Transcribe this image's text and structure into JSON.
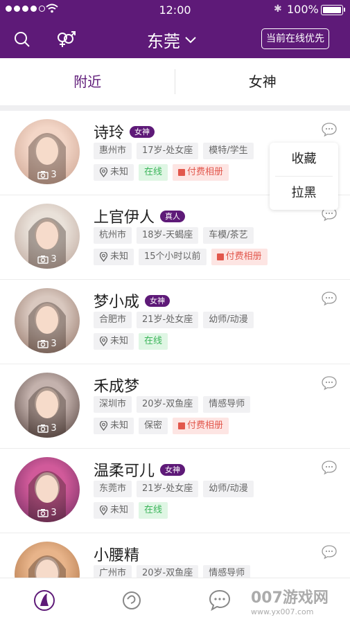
{
  "status_bar": {
    "time": "12:00",
    "battery": "100%",
    "battery_level": 1.0
  },
  "nav": {
    "city": "东莞",
    "online_first": "当前在线优先"
  },
  "tabs": [
    {
      "label": "附近",
      "active": true
    },
    {
      "label": "女神",
      "active": false
    }
  ],
  "popup_menu": {
    "favorite": "收藏",
    "block": "拉黑"
  },
  "users": [
    {
      "name": "诗玲",
      "badge": "女神",
      "photo_count": "3",
      "tags1": [
        "惠州市",
        "17岁-处女座",
        "模特/学生"
      ],
      "location": "未知",
      "status": "在线",
      "status_kind": "online",
      "paid": "付费相册"
    },
    {
      "name": "上官伊人",
      "badge": "真人",
      "photo_count": "3",
      "tags1": [
        "杭州市",
        "18岁-天蝎座",
        "车模/茶艺"
      ],
      "location": "未知",
      "status": "15个小时以前",
      "status_kind": "plain",
      "paid": "付费相册"
    },
    {
      "name": "梦小成",
      "badge": "女神",
      "photo_count": "3",
      "tags1": [
        "合肥市",
        "21岁-处女座",
        "幼师/动漫"
      ],
      "location": "未知",
      "status": "在线",
      "status_kind": "online",
      "paid": ""
    },
    {
      "name": "禾成梦",
      "badge": "",
      "photo_count": "3",
      "tags1": [
        "深圳市",
        "20岁-双鱼座",
        "情感导师"
      ],
      "location": "未知",
      "status": "保密",
      "status_kind": "plain",
      "paid": "付费相册"
    },
    {
      "name": "温柔可儿",
      "badge": "女神",
      "photo_count": "3",
      "tags1": [
        "东莞市",
        "21岁-处女座",
        "幼师/动漫"
      ],
      "location": "未知",
      "status": "在线",
      "status_kind": "online",
      "paid": ""
    },
    {
      "name": "小腰精",
      "badge": "",
      "photo_count": "",
      "tags1": [
        "广州市",
        "20岁-双鱼座",
        "情感导师"
      ],
      "location": "",
      "status": "",
      "status_kind": "plain",
      "paid": ""
    }
  ],
  "watermark": {
    "brand": "007游戏网",
    "url": "www.yx007.com"
  },
  "colors": {
    "primary": "#5e1a78",
    "online_bg": "#dff6e4",
    "online_fg": "#3bb55a",
    "paid_bg": "#fde5e3",
    "paid_fg": "#e2574c"
  },
  "icons": [
    "search-icon",
    "gender-filter-icon",
    "chevron-down-icon",
    "more-chat-icon",
    "camera-icon",
    "location-pin-icon",
    "home-tab-icon",
    "discover-tab-icon",
    "message-tab-icon"
  ]
}
